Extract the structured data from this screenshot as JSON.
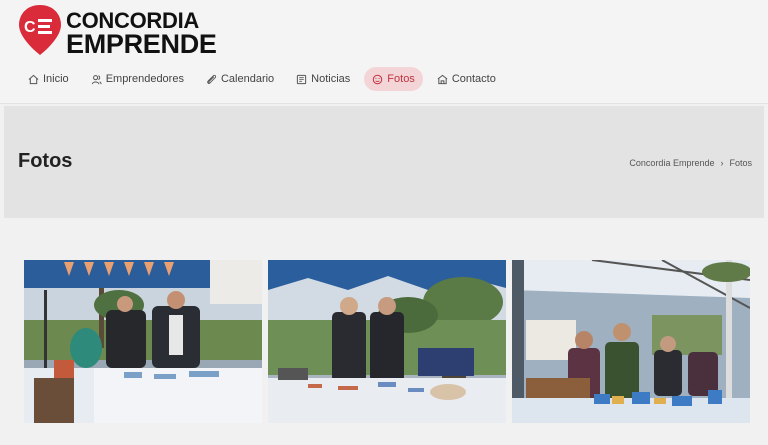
{
  "brand": {
    "line1": "CONCORDIA",
    "line2": "EMPRENDE",
    "color": "#d92b3a"
  },
  "nav": {
    "items": [
      {
        "label": "Inicio",
        "icon": "home-icon"
      },
      {
        "label": "Emprendedores",
        "icon": "users-icon"
      },
      {
        "label": "Calendario",
        "icon": "paperclip-icon"
      },
      {
        "label": "Noticias",
        "icon": "newspaper-icon"
      },
      {
        "label": "Fotos",
        "icon": "smile-icon",
        "active": true
      },
      {
        "label": "Contacto",
        "icon": "building-icon"
      }
    ]
  },
  "page": {
    "title": "Fotos"
  },
  "breadcrumb": {
    "home": "Concordia Emprende",
    "current": "Fotos"
  },
  "colors": {
    "accent": "#c0333f",
    "active_bg": "#f3d5d8",
    "banner_bg": "#e3e3e3"
  }
}
